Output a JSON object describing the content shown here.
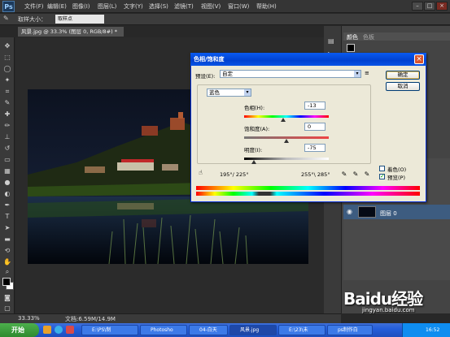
{
  "app": {
    "logo": "Ps"
  },
  "menus": [
    "文件(F)",
    "编辑(E)",
    "图像(I)",
    "图层(L)",
    "文字(Y)",
    "选择(S)",
    "滤镜(T)",
    "视图(V)",
    "窗口(W)",
    "帮助(H)"
  ],
  "options": {
    "sample_label": "取样大小：",
    "sample_value": "取样点"
  },
  "document": {
    "tab_title": "风景.jpg @ 33.3% (图层 0, RGB/8#) *",
    "zoom": "33.33%",
    "info": "文档:6.59M/14.9M"
  },
  "dialog": {
    "title": "色相/饱和度",
    "preset_label": "预设(E):",
    "preset_value": "自定",
    "ok": "确定",
    "cancel": "取消",
    "channel": "蓝色",
    "hue_label": "色相(H):",
    "hue_value": "-13",
    "saturation_label": "饱和度(A):",
    "saturation_value": "0",
    "lightness_label": "明度(I):",
    "lightness_value": "-75",
    "range_left": "195°/ 225°",
    "range_right": "255°\\ 285°",
    "colorize_label": "着色(O)",
    "colorize_checked": false,
    "preview_label": "预览(P)",
    "preview_checked": true,
    "hue_slider_fraction": 0.46,
    "saturation_slider_fraction": 0.5,
    "lightness_slider_fraction": 0.12
  },
  "panels": {
    "color_tab": "颜色",
    "swatches_tab": "色板",
    "layer_name": "图层 0"
  },
  "taskbar": {
    "start": "开始",
    "items": [
      "E:\\PS\\制",
      "Photosho",
      "04-白天",
      "风景.jpg",
      "E:\\23\\未",
      "ps制作白"
    ],
    "time": "16:52"
  },
  "watermark": {
    "brand": "Baidu经验",
    "url": "jingyan.baidu.com"
  },
  "colors": {
    "titlebar": "#0a5af0",
    "ps_dark": "#282828",
    "taskbar": "#245edb",
    "start_green": "#3c9c3c"
  }
}
